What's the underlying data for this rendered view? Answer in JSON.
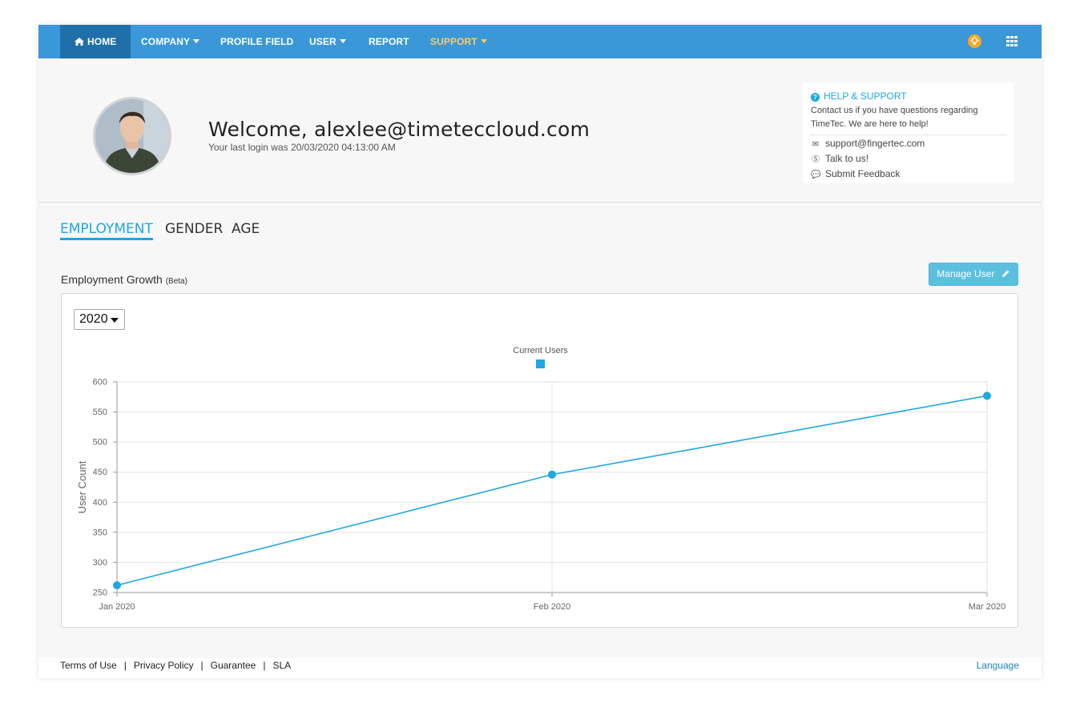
{
  "nav": {
    "home": "HOME",
    "company": "COMPANY",
    "profile_field": "PROFILE FIELD",
    "user": "USER",
    "report": "REPORT",
    "support": "SUPPORT",
    "icons": [
      "home-icon",
      "lightbulb-icon",
      "apps-grid-icon"
    ],
    "colors": {
      "bar": "#3a98d8",
      "active": "#1f6fa8",
      "support": "#ffc869"
    }
  },
  "header": {
    "welcome": "Welcome, alexlee@timeteccloud.com",
    "last_login": "Your last login was 20/03/2020 04:13:00 AM"
  },
  "help": {
    "title": "HELP & SUPPORT",
    "text": "Contact us if you have questions regarding TimeTec. We are here to help!",
    "email": "support@fingertec.com",
    "talk": "Talk to us!",
    "feedback": "Submit Feedback"
  },
  "tabs": [
    "EMPLOYMENT",
    "GENDER",
    "AGE"
  ],
  "section": {
    "title": "Employment Growth",
    "beta": "(Beta)"
  },
  "manage_button": "Manage User",
  "year": "2020",
  "chart_data": {
    "type": "line",
    "title": "",
    "legend": "Current Users",
    "legend_position": "top-center",
    "ylabel": "User Count",
    "xlabel": "",
    "categories": [
      "Jan 2020",
      "Feb 2020",
      "Mar 2020"
    ],
    "series": [
      {
        "name": "Current Users",
        "values": [
          262,
          446,
          577
        ],
        "color": "#1ea7e0"
      }
    ],
    "ylim": [
      250,
      600
    ],
    "yticks": [
      250,
      300,
      350,
      400,
      450,
      500,
      550,
      600
    ],
    "grid": true
  },
  "footer": {
    "terms": "Terms of Use",
    "privacy": "Privacy Policy",
    "guarantee": "Guarantee",
    "sla": "SLA",
    "separator": "|",
    "language": "Language"
  }
}
